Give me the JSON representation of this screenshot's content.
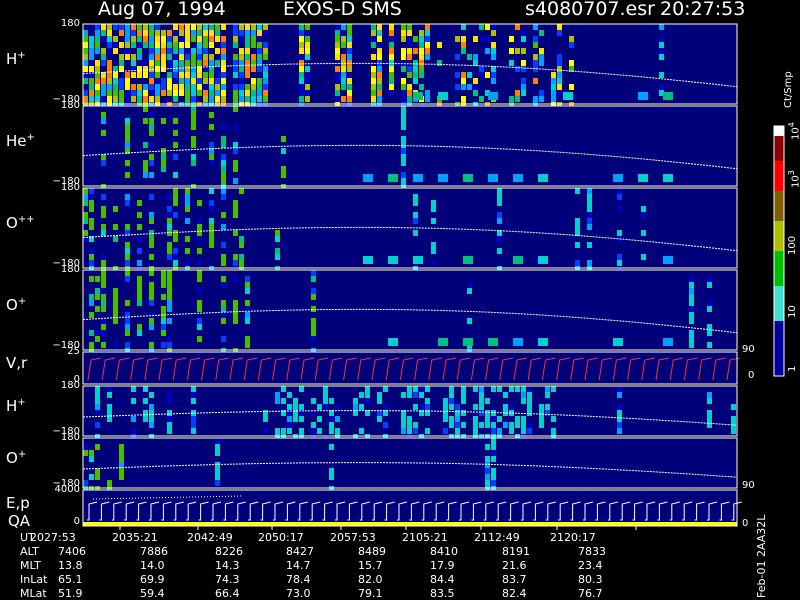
{
  "header": {
    "date": "Aug 07, 1994",
    "instrument": "EXOS-D SMS",
    "file": "s4080707.esr",
    "time": "20:27:53"
  },
  "panels": [
    {
      "id": "h1",
      "label": "H",
      "sup": "+",
      "ytop": "180",
      "ybot": "−180",
      "rtick": ""
    },
    {
      "id": "he",
      "label": "He",
      "sup": "+",
      "ytop": "180",
      "ybot": "−180",
      "rtick": ""
    },
    {
      "id": "opp",
      "label": "O",
      "sup": "++",
      "ytop": "180",
      "ybot": "−180",
      "rtick": ""
    },
    {
      "id": "o1",
      "label": "O",
      "sup": "+",
      "ytop": "180",
      "ybot": "−180",
      "rtick": ""
    },
    {
      "id": "vr",
      "label": "V,r",
      "sup": "",
      "ytop": "25",
      "ybot": "0",
      "rtick": "90",
      "rtick2": "0"
    },
    {
      "id": "h2",
      "label": "H",
      "sup": "+",
      "ytop": "180",
      "ybot": "−180",
      "rtick": ""
    },
    {
      "id": "o2",
      "label": "O",
      "sup": "+",
      "ytop": "180",
      "ybot": "−180",
      "rtick": "90"
    },
    {
      "id": "ep",
      "label": "E,p",
      "sup": "",
      "label2": "QA",
      "ytop": "4000",
      "ybot": "0",
      "rtick": "0"
    }
  ],
  "colorbar": {
    "unit": "Ct/Smp",
    "ticks": [
      {
        "base": "10",
        "exp": "4"
      },
      {
        "base": "10",
        "exp": "3"
      },
      {
        "base": "100",
        "exp": ""
      },
      {
        "base": "10",
        "exp": ""
      },
      {
        "base": "1",
        "exp": ""
      }
    ],
    "colors": [
      "#ffffff",
      "#8b0000",
      "#ff0000",
      "#806000",
      "#b0c000",
      "#00c000",
      "#40e0d0",
      "#0000a0"
    ]
  },
  "side_label": "Feb-01 2AA32L",
  "orbit_table": {
    "rows": [
      {
        "label": "UT",
        "values": [
          "2027:53",
          "2035:21",
          "2042:49",
          "2050:17",
          "2057:53",
          "2105:21",
          "2112:49",
          "2120:17"
        ]
      },
      {
        "label": "ALT",
        "values": [
          "7406",
          "7886",
          "8226",
          "8427",
          "8489",
          "8410",
          "8191",
          "7833"
        ]
      },
      {
        "label": "MLT",
        "values": [
          "13.8",
          "14.0",
          "14.3",
          "14.7",
          "15.7",
          "17.9",
          "21.6",
          "23.4"
        ]
      },
      {
        "label": "InLat",
        "values": [
          "65.1",
          "69.9",
          "74.3",
          "78.4",
          "82.0",
          "84.4",
          "83.7",
          "80.3"
        ]
      },
      {
        "label": "MLat",
        "values": [
          "51.9",
          "59.4",
          "66.4",
          "73.0",
          "79.1",
          "83.5",
          "82.4",
          "76.7"
        ]
      }
    ]
  },
  "chart_data": {
    "type": "heatmap",
    "title": "Aug 07, 1994   EXOS-D SMS",
    "x": [
      "2027:53",
      "2035:21",
      "2042:49",
      "2050:17",
      "2057:53",
      "2105:21",
      "2112:49",
      "2120:17"
    ],
    "series": [
      {
        "name": "H+",
        "ylim": [
          -180,
          180
        ]
      },
      {
        "name": "He+",
        "ylim": [
          -180,
          180
        ]
      },
      {
        "name": "O++",
        "ylim": [
          -180,
          180
        ]
      },
      {
        "name": "O+",
        "ylim": [
          -180,
          180
        ]
      },
      {
        "name": "V,r",
        "ylim": [
          0,
          25
        ]
      },
      {
        "name": "H+",
        "ylim": [
          -180,
          180
        ]
      },
      {
        "name": "O+",
        "ylim": [
          -180,
          180
        ]
      },
      {
        "name": "E,p",
        "ylim": [
          0,
          4000
        ]
      }
    ],
    "colorbar": {
      "label": "Ct/Smp",
      "scale": "log",
      "range": [
        1,
        10000
      ]
    }
  }
}
